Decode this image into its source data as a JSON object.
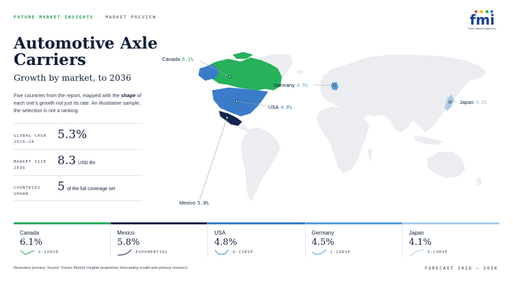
{
  "header": {
    "brand": "FUTURE MARKET INSIGHTS",
    "separator": "·",
    "section": "MARKET PREVIEW",
    "logo_text": "fmi",
    "logo_subtext": "Future Market Insights Inc."
  },
  "title": "Automotive Axle Carriers",
  "subtitle": "Growth by market, to 2036",
  "description": {
    "part1": "Five countries from the report, mapped with the ",
    "bold": "shape",
    "part2": " of each one's growth not just its rate. An illustrative sample; the selection is not a ranking."
  },
  "stats": [
    {
      "label_line1": "GLOBAL CAGR",
      "label_line2": "2026–36",
      "value": "5.3%",
      "unit": ""
    },
    {
      "label_line1": "MARKET SIZE",
      "label_line2": "2036",
      "value": "8.3",
      "unit": "USD Bn"
    },
    {
      "label_line1": "COUNTRIES",
      "label_line2": "SHOWN",
      "value": "5",
      "unit": "of the full coverage set"
    }
  ],
  "map_labels": [
    {
      "country": "Canada",
      "value": "6.1%"
    },
    {
      "country": "Germany",
      "value": "4.5%"
    },
    {
      "country": "USA",
      "value": "4.8%"
    },
    {
      "country": "Japan",
      "value": "4.1%"
    },
    {
      "country": "Mexico",
      "value": "5.8%"
    }
  ],
  "cards": [
    {
      "country": "Canada",
      "value": "6.1%",
      "shape": "V-CURVE",
      "icon": "v-curve-icon",
      "color": "#27b15a"
    },
    {
      "country": "Mexico",
      "value": "5.8%",
      "shape": "EXPONENTIAL",
      "icon": "exponential-icon",
      "color": "#14264d"
    },
    {
      "country": "USA",
      "value": "4.8%",
      "shape": "U-CURVE",
      "icon": "u-curve-icon",
      "color": "#3a7cc9"
    },
    {
      "country": "Germany",
      "value": "4.5%",
      "shape": "J-CURVE",
      "icon": "j-curve-icon",
      "color": "#5b9ddb"
    },
    {
      "country": "Japan",
      "value": "4.1%",
      "shape": "S-CURVE",
      "icon": "s-curve-icon",
      "color": "#a9cdea"
    }
  ],
  "footer": {
    "note": "Illustrative preview. Source: Future Market Insights proprietary forecasting model and primary research.",
    "forecast": "FORECAST 2026 – 2036"
  }
}
